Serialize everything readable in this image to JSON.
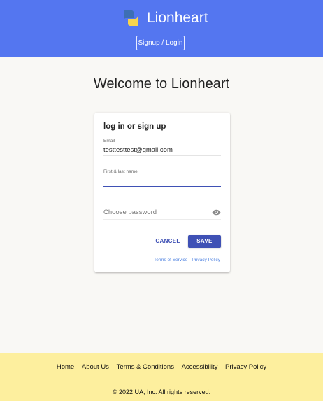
{
  "header": {
    "brand_name": "Lionheart",
    "signup_label": "Signup / Login",
    "background": "#5476f0"
  },
  "main": {
    "welcome": "Welcome to Lionheart"
  },
  "card": {
    "title": "log in or sign up",
    "email": {
      "label": "Email",
      "value": "testtesttest@gmail.com"
    },
    "name": {
      "label": "First & last name",
      "value": ""
    },
    "password": {
      "placeholder": "Choose password",
      "icon": "eye-icon"
    },
    "cancel_label": "CANCEL",
    "save_label": "SAVE",
    "terms_label": "Terms of Service",
    "privacy_label": "Privacy Policy",
    "accent": "#3f51b5"
  },
  "footer": {
    "links": [
      "Home",
      "About Us",
      "Terms & Conditions",
      "Accessibility",
      "Privacy Policy"
    ],
    "copyright": "© 2022 UA, Inc. All rights reserved.",
    "background": "#fdef9e"
  }
}
